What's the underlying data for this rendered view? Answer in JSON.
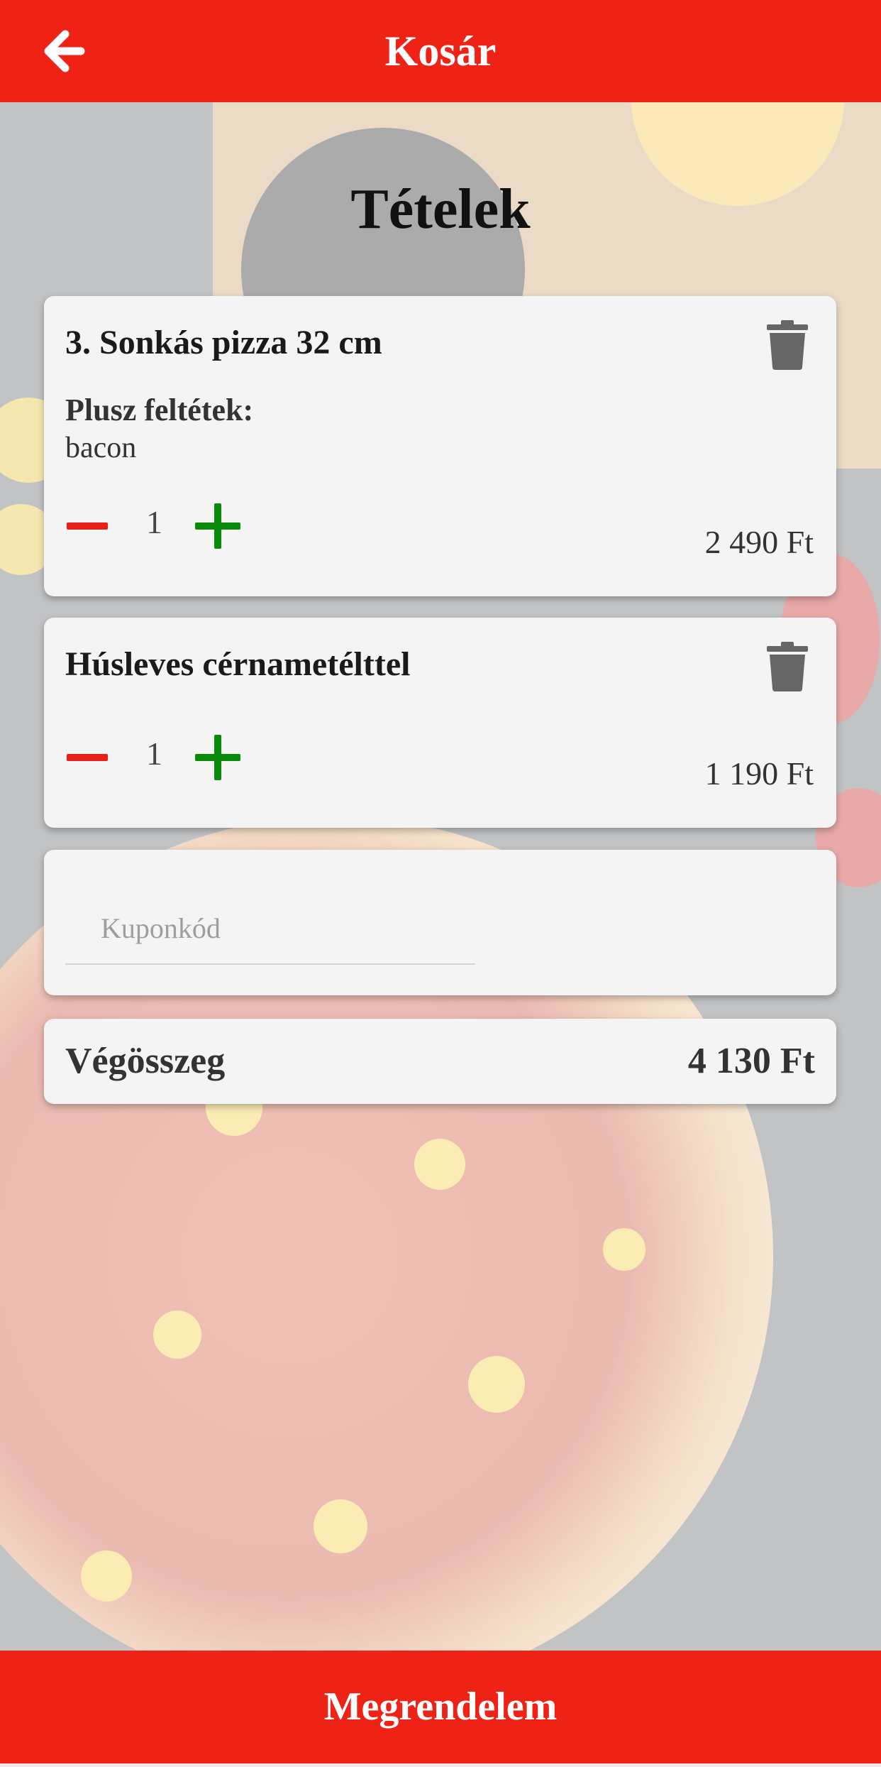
{
  "header": {
    "title": "Kosár",
    "back_icon": "arrow-left-icon"
  },
  "colors": {
    "brand_red": "#ee2316",
    "minus_red": "#e8201a",
    "plus_green": "#0a8a0a",
    "trash_gray": "#666666"
  },
  "main": {
    "title": "Tételek"
  },
  "cart": {
    "items": [
      {
        "name": "3. Sonkás pizza 32 cm",
        "extras_label": "Plusz feltétek:",
        "extras_value": "bacon",
        "quantity": "1",
        "price": "2 490 Ft"
      },
      {
        "name": "Húsleves cérnametélttel",
        "quantity": "1",
        "price": "1 190 Ft"
      }
    ]
  },
  "coupon": {
    "placeholder": "Kuponkód",
    "value": ""
  },
  "total": {
    "label": "Végösszeg",
    "value": "4 130 Ft"
  },
  "footer": {
    "order_label": "Megrendelem"
  }
}
